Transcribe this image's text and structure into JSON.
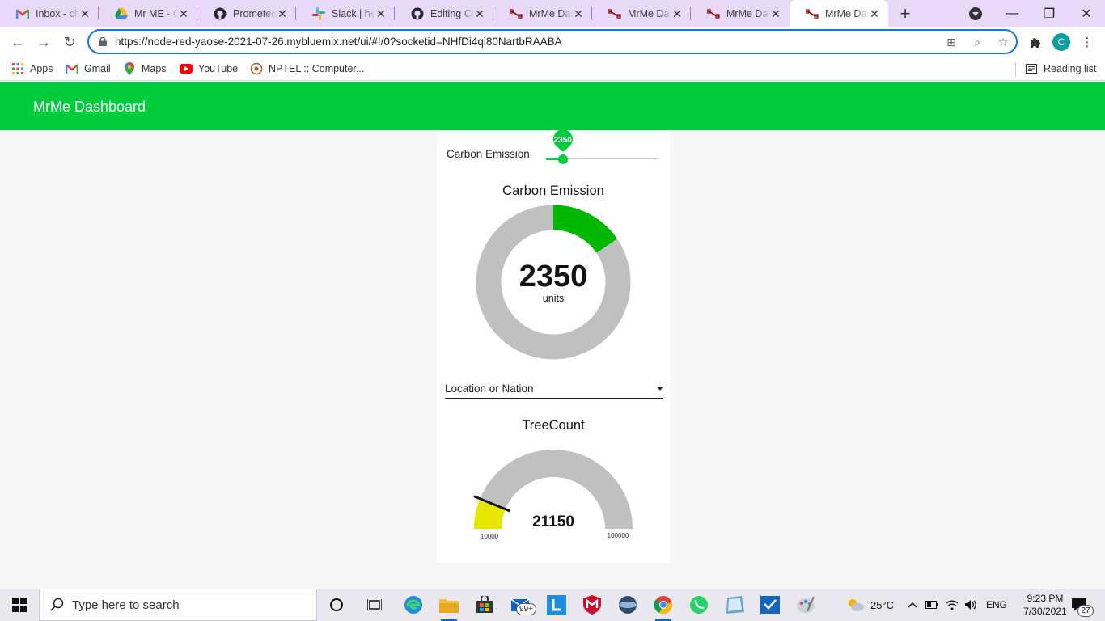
{
  "browser": {
    "tabs": [
      {
        "title": "Inbox - chr",
        "icon": "gmail-icon",
        "active": false
      },
      {
        "title": "Mr ME - Ca",
        "icon": "google-drive-icon",
        "active": false
      },
      {
        "title": "Prometeo-",
        "icon": "github-icon",
        "active": false
      },
      {
        "title": "Slack | help",
        "icon": "slack-icon",
        "active": false
      },
      {
        "title": "Editing Ch",
        "icon": "github-icon",
        "active": false
      },
      {
        "title": "MrMe Dash",
        "icon": "node-red-icon",
        "active": false
      },
      {
        "title": "MrMe Dash",
        "icon": "node-red-icon",
        "active": false
      },
      {
        "title": "MrMe Dash",
        "icon": "node-red-icon",
        "active": false
      },
      {
        "title": "MrMe Dash",
        "icon": "node-red-icon",
        "active": true
      }
    ],
    "url": "https://node-red-yaose-2021-07-26.mybluemix.net/ui/#!/0?socketid=NHfDi4qi80NartbRAABA",
    "profile_initial": "C",
    "bookmarks": [
      {
        "label": "Apps",
        "icon": "apps-grid-icon"
      },
      {
        "label": "Gmail",
        "icon": "gmail-icon"
      },
      {
        "label": "Maps",
        "icon": "maps-pin-icon"
      },
      {
        "label": "YouTube",
        "icon": "youtube-icon"
      },
      {
        "label": "NPTEL :: Computer...",
        "icon": "nptel-icon"
      }
    ],
    "reading_list_label": "Reading list"
  },
  "dashboard": {
    "title": "MrMe Dashboard",
    "accent_color": "#00cc3c",
    "slider": {
      "label": "Carbon Emission",
      "value": "2350",
      "fraction": 0.15
    },
    "carbon_gauge": {
      "title": "Carbon Emission",
      "value": "2350",
      "units": "units",
      "fraction": 0.155,
      "color": "#00b800",
      "track_color": "#c0c0c0"
    },
    "location_dropdown": {
      "placeholder": "Location or Nation"
    },
    "tree_gauge": {
      "title": "TreeCount",
      "value": "21150",
      "min": "10000",
      "max": "100000",
      "fraction": 0.124,
      "color": "#e6e600",
      "track_color": "#c0c0c0"
    }
  },
  "taskbar": {
    "search_placeholder": "Type here to search",
    "mail_badge": "99+",
    "weather": "25°C",
    "language": "ENG",
    "time": "9:23 PM",
    "date": "7/30/2021",
    "notifications": "27"
  }
}
